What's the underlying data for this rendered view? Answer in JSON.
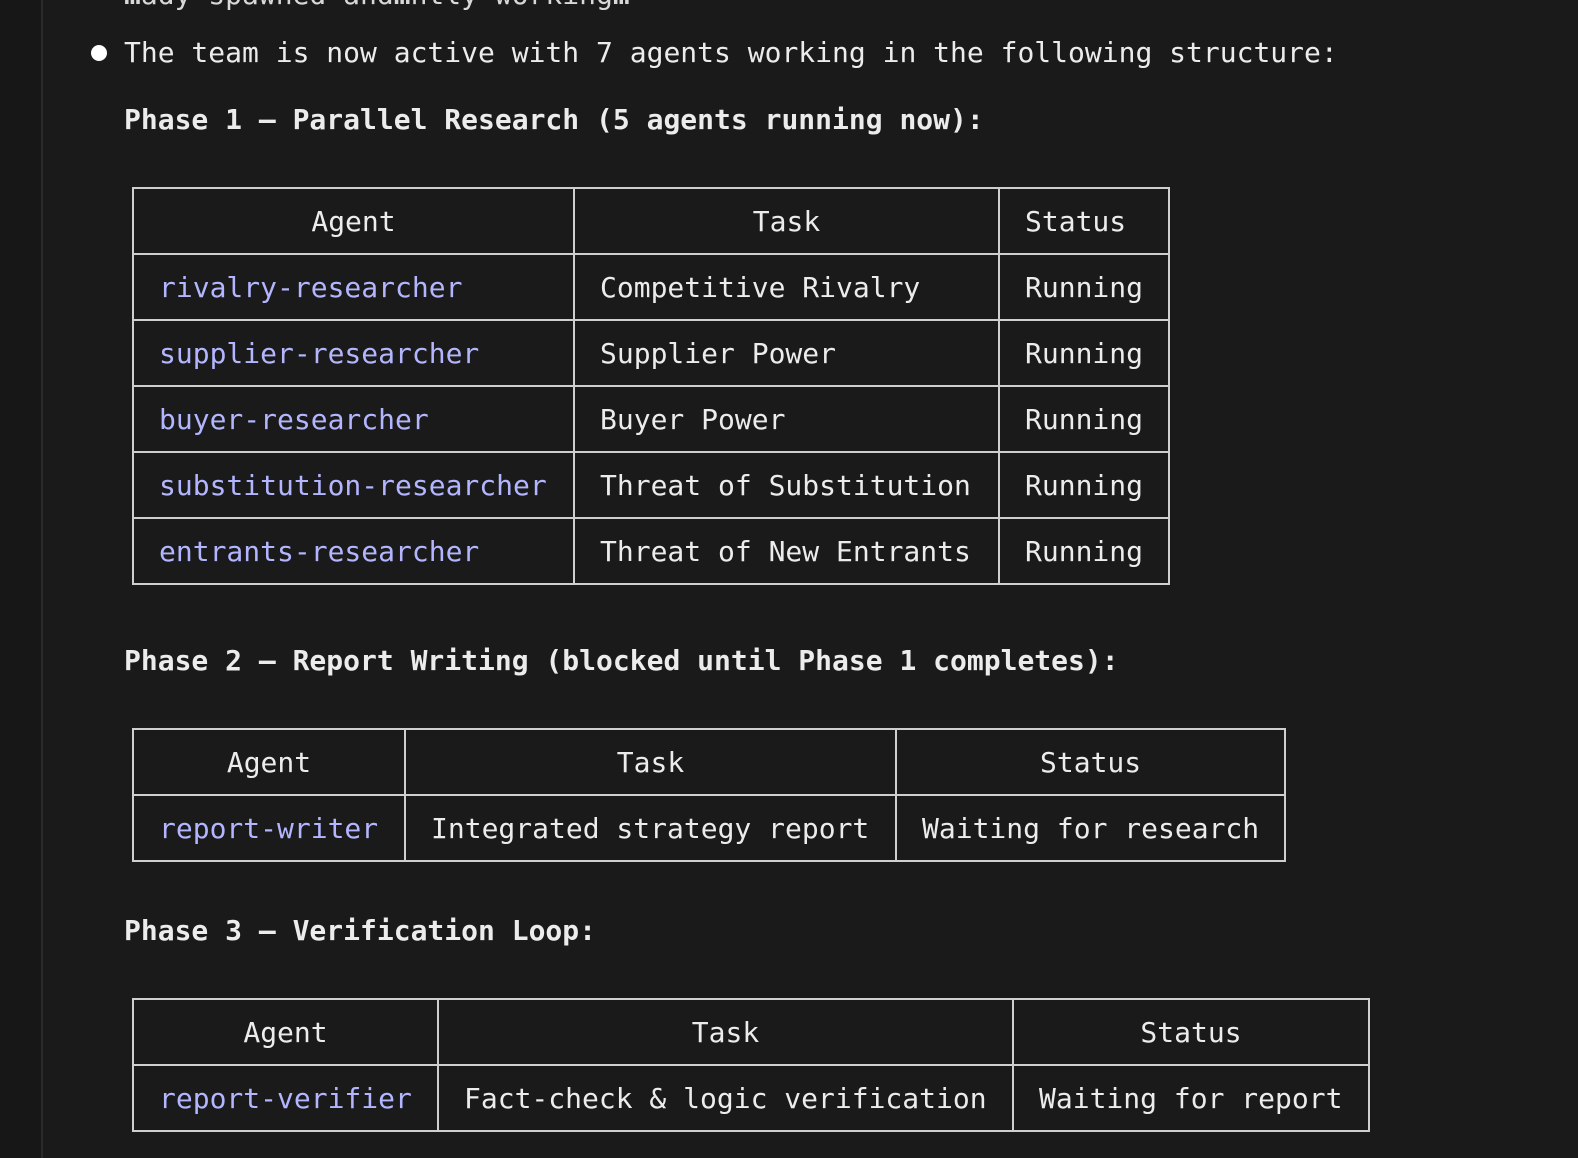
{
  "intro": {
    "top_clipped_text": "…ady spawned and…ntly working…",
    "line": "The team is now active with 7 agents working in the following structure:"
  },
  "phases": [
    {
      "heading": "Phase 1 – Parallel Research (5 agents running now):",
      "columns": [
        "Agent",
        "Task",
        "Status"
      ],
      "rows": [
        {
          "agent": "rivalry-researcher",
          "task": "Competitive Rivalry",
          "status": "Running"
        },
        {
          "agent": "supplier-researcher",
          "task": "Supplier Power",
          "status": "Running"
        },
        {
          "agent": "buyer-researcher",
          "task": "Buyer Power",
          "status": "Running"
        },
        {
          "agent": "substitution-researcher",
          "task": "Threat of Substitution",
          "status": "Running"
        },
        {
          "agent": "entrants-researcher",
          "task": "Threat of New Entrants",
          "status": "Running"
        }
      ]
    },
    {
      "heading": "Phase 2 – Report Writing (blocked until Phase 1 completes):",
      "columns": [
        "Agent",
        "Task",
        "Status"
      ],
      "rows": [
        {
          "agent": "report-writer",
          "task": "Integrated strategy report",
          "status": "Waiting for research"
        }
      ]
    },
    {
      "heading": "Phase 3 – Verification Loop:",
      "columns": [
        "Agent",
        "Task",
        "Status"
      ],
      "rows": [
        {
          "agent": "report-verifier",
          "task": "Fact-check & logic verification",
          "status": "Waiting for report"
        }
      ]
    }
  ],
  "colors": {
    "background": "#1a1a1a",
    "text": "#ececec",
    "agent_name": "#b3b6ff",
    "table_border": "#cfcfcf"
  }
}
